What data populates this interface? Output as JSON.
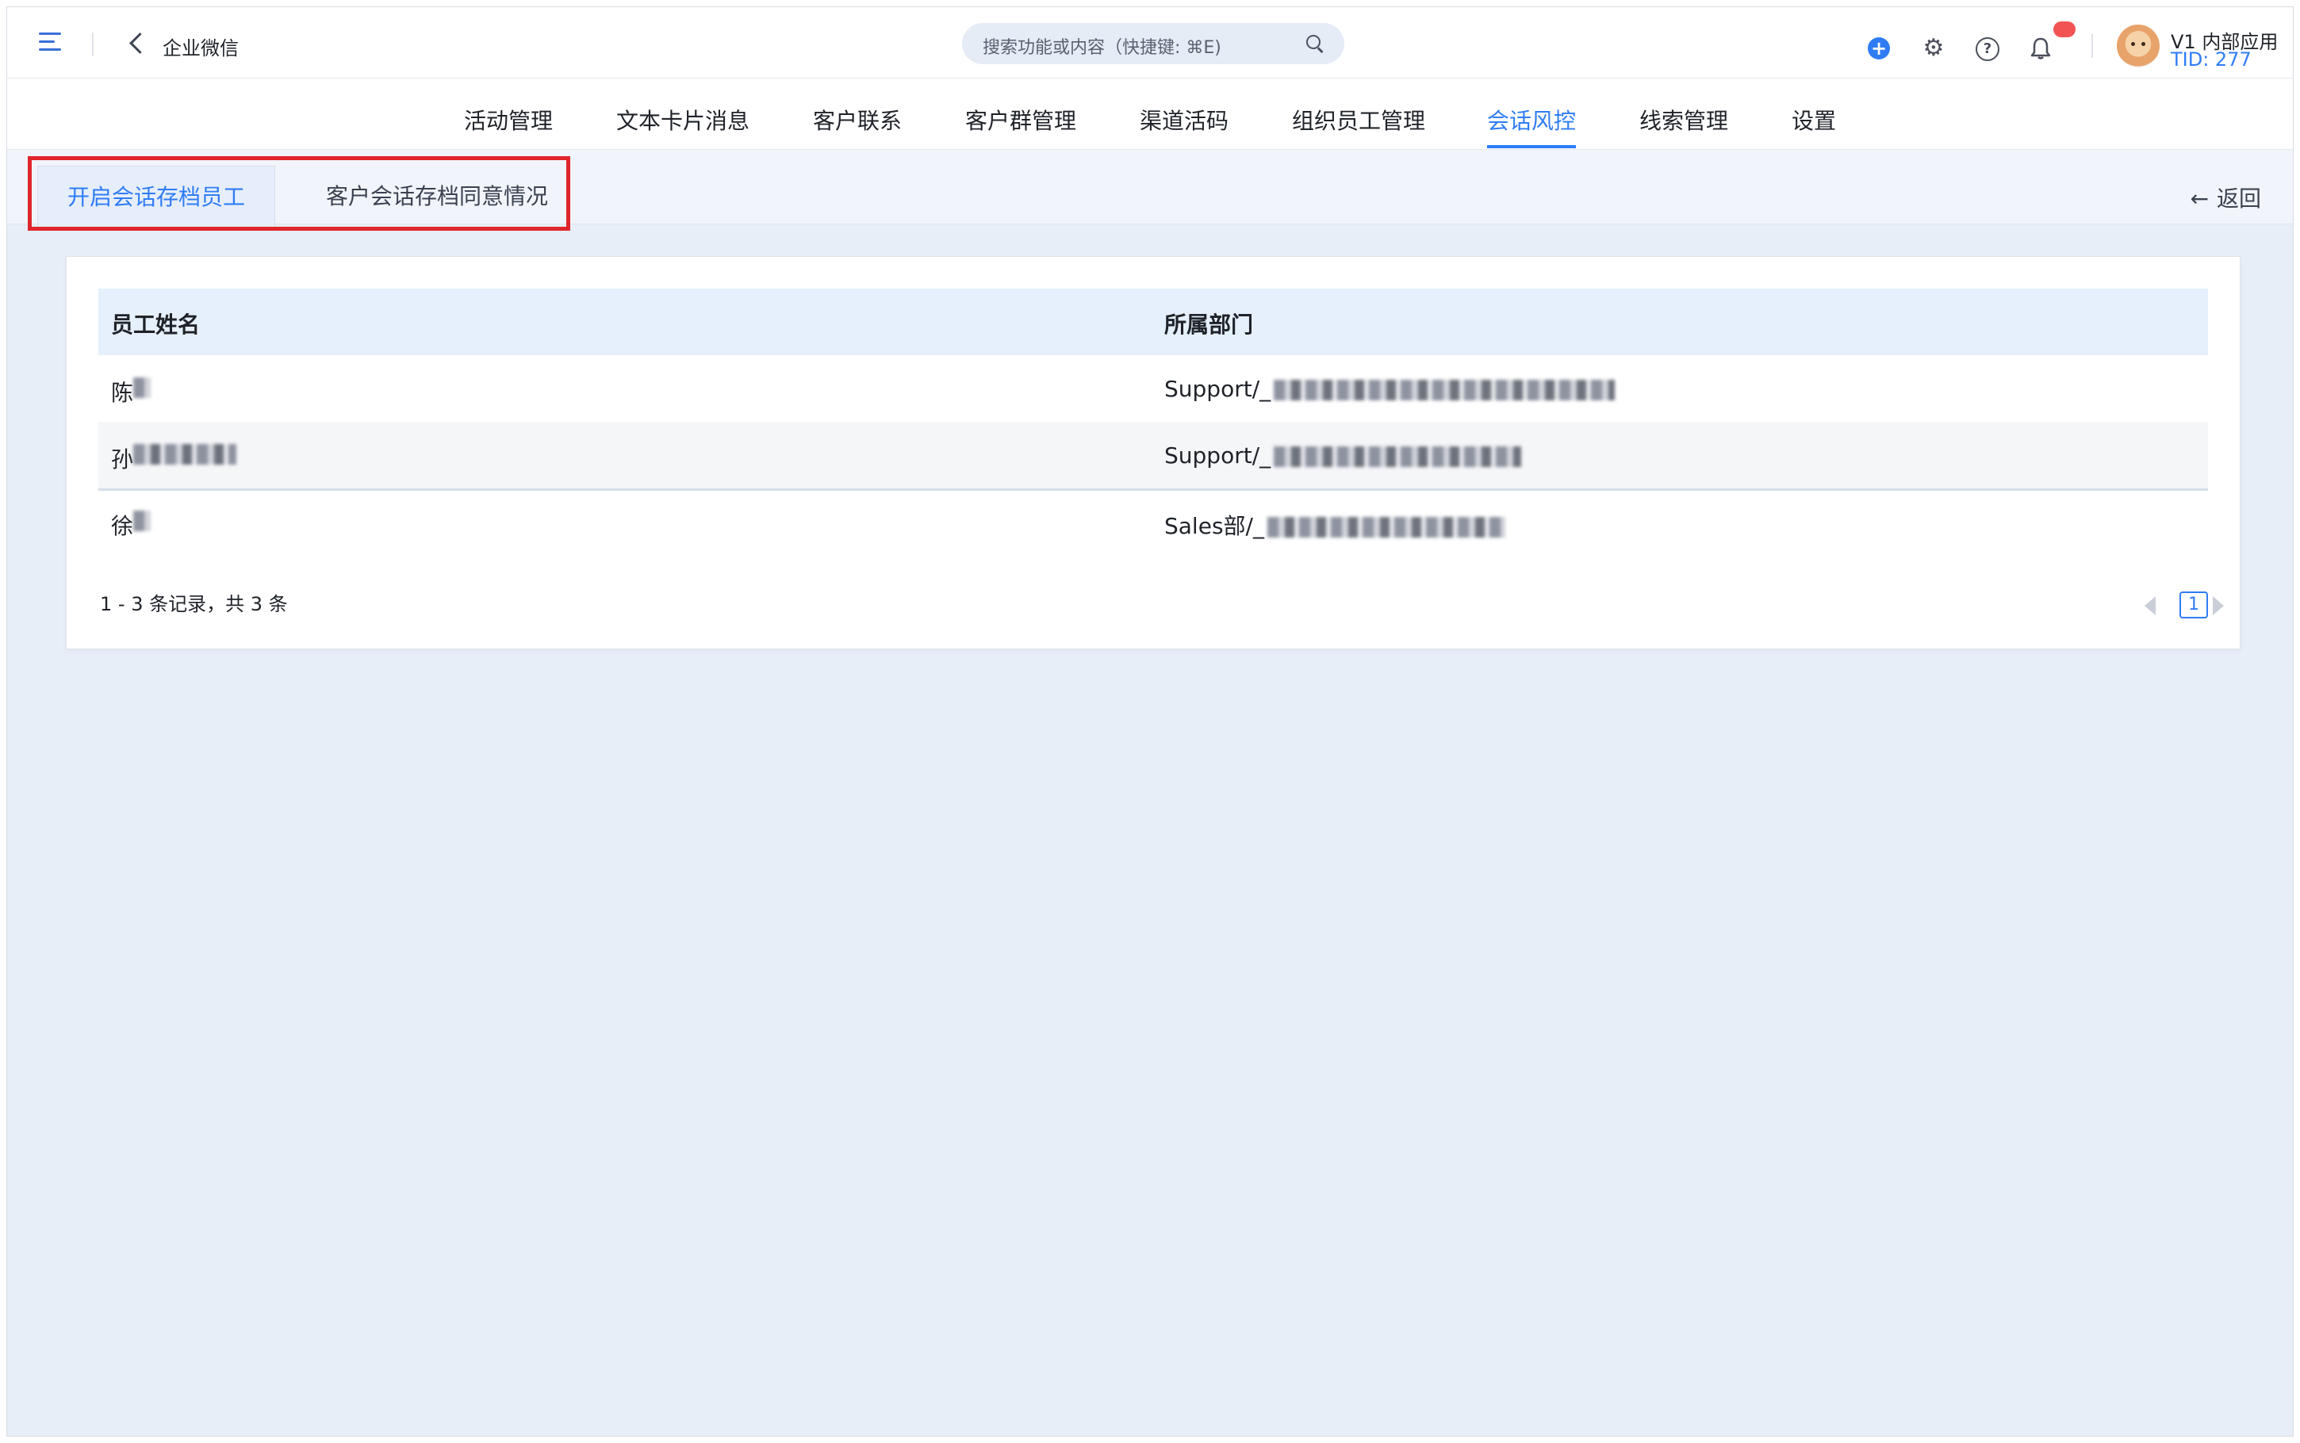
{
  "header": {
    "app_title": "企业微信",
    "search_placeholder": "搜索功能或内容（快捷键: ⌘E)",
    "user_name": "V1 内部应用",
    "tid": "TID: 277"
  },
  "nav": {
    "items": [
      {
        "label": "活动管理"
      },
      {
        "label": "文本卡片消息"
      },
      {
        "label": "客户联系"
      },
      {
        "label": "客户群管理"
      },
      {
        "label": "渠道活码"
      },
      {
        "label": "组织员工管理"
      },
      {
        "label": "会话风控",
        "active": true
      },
      {
        "label": "线索管理"
      },
      {
        "label": "设置"
      }
    ]
  },
  "subtabs": {
    "items": [
      {
        "label": "开启会话存档员工",
        "active": true
      },
      {
        "label": "客户会话存档同意情况"
      }
    ],
    "return_label": "返回"
  },
  "table": {
    "columns": [
      "员工姓名",
      "所属部门"
    ],
    "rows": [
      {
        "name": "陈",
        "dept": "Support/_"
      },
      {
        "name": "孙",
        "dept": "Support/_"
      },
      {
        "name": "徐",
        "dept": "Sales部/_"
      }
    ],
    "footer": "1 - 3 条记录，共 3 条",
    "page": "1"
  },
  "colors": {
    "accent": "#2f7cf5",
    "highlight": "#e0252b",
    "badge": "#f25454"
  }
}
